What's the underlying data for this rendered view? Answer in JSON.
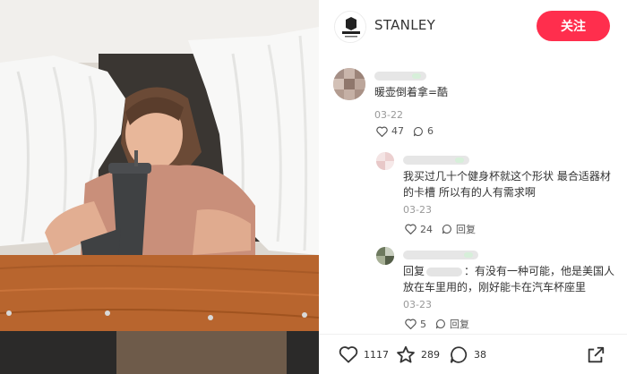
{
  "header": {
    "brand_name": "STANLEY",
    "follow_label": "关注",
    "avatar_brand_text": "STANLEY"
  },
  "comments": [
    {
      "text": "暖壶倒着拿=酷",
      "date": "03-22",
      "likes": "47",
      "replies": "6"
    },
    {
      "text_line1": "我买过几十个健身杯就这个形状 最合适器材",
      "text_line2": "的卡槽 所以有的人有需求啊",
      "date": "03-23",
      "likes": "24",
      "reply_label": "回复"
    },
    {
      "text_prefix": "回复",
      "text_line1_rest": "：有没有一种可能，他是美国人",
      "text_line2": "放在车里用的，刚好能卡在汽车杯座里",
      "date": "03-23",
      "likes": "5",
      "reply_label": "回复"
    }
  ],
  "footer": {
    "likes": "1117",
    "collects": "289",
    "comments": "38"
  },
  "colors": {
    "follow_button": "#ff2e4d",
    "secondary_text": "#999999"
  },
  "icons": [
    "heart-icon",
    "comment-icon",
    "star-icon",
    "share-icon"
  ]
}
